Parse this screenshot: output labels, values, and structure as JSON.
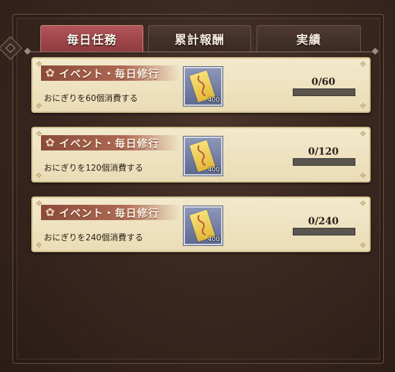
{
  "tabs": [
    {
      "label": "毎日任務",
      "active": true
    },
    {
      "label": "累計報酬",
      "active": false
    },
    {
      "label": "実績",
      "active": false
    }
  ],
  "missions": [
    {
      "title": "イベント・毎日修行",
      "description": "おにぎりを60個消費する",
      "reward_icon": "ticket-icon",
      "reward_qty": "400",
      "progress_text": "0/60",
      "progress": 0
    },
    {
      "title": "イベント・毎日修行",
      "description": "おにぎりを120個消費する",
      "reward_icon": "ticket-icon",
      "reward_qty": "400",
      "progress_text": "0/120",
      "progress": 0
    },
    {
      "title": "イベント・毎日修行",
      "description": "おにぎりを240個消費する",
      "reward_icon": "ticket-icon",
      "reward_qty": "400",
      "progress_text": "0/240",
      "progress": 0
    }
  ],
  "colors": {
    "active_tab": "#a44a4e",
    "card_bg": "#efe4c4",
    "bar_track": "#5a554f"
  }
}
